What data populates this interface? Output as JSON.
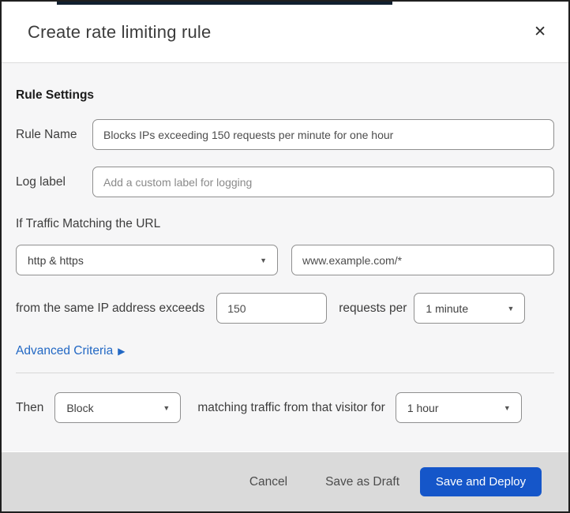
{
  "dialog": {
    "title": "Create rate limiting rule"
  },
  "icons": {
    "close": "✕",
    "caret_down": "▼",
    "arrow_right": "▶"
  },
  "colors": {
    "primary_button_blue": "#1556C9",
    "link_blue": "#2268C4",
    "body_bg": "#F6F6F7",
    "footer_bg": "#DADADA",
    "control_border": "#8F8F8F",
    "top_strip_navy": "#11202F"
  },
  "form": {
    "section_heading": "Rule Settings",
    "rule_name": {
      "label": "Rule Name",
      "value": "Blocks IPs exceeding 150 requests per minute for one hour"
    },
    "log_label": {
      "label": "Log label",
      "placeholder": "Add a custom label for logging"
    },
    "traffic_match": {
      "heading": "If Traffic Matching the URL",
      "scheme_selected": "http & https",
      "url_value": "www.example.com/*"
    },
    "threshold": {
      "prefix": "from the same IP address exceeds",
      "requests_value": "150",
      "middle": "requests per",
      "period_selected": "1 minute"
    },
    "advanced_criteria_label": "Advanced Criteria",
    "then": {
      "prefix": "Then",
      "action_selected": "Block",
      "middle": "matching traffic from that visitor for",
      "duration_selected": "1 hour"
    }
  },
  "footer": {
    "cancel_label": "Cancel",
    "save_draft_label": "Save as Draft",
    "save_deploy_label": "Save and Deploy"
  }
}
